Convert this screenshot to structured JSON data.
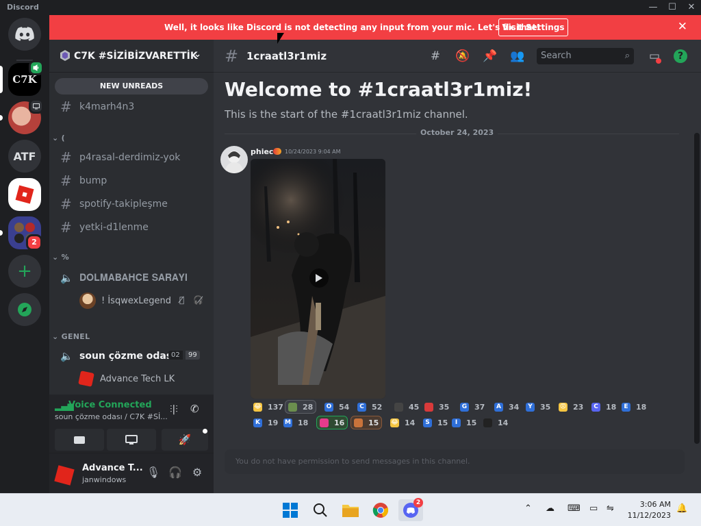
{
  "window": {
    "title": "Discord",
    "min": "—",
    "max": "☐",
    "close": "✕"
  },
  "notice": {
    "text": "Well, it looks like Discord is not detecting any input from your mic. Let's fix that!",
    "button": "Visit Settings",
    "close": "✕"
  },
  "rail": {
    "servers": [
      {
        "name": "Discord home",
        "label": ""
      },
      {
        "name": "C7K",
        "label": "C7K"
      },
      {
        "name": "avatar-server",
        "label": ""
      },
      {
        "name": "ATF",
        "label": "ATF"
      },
      {
        "name": "Roblox",
        "label": ""
      },
      {
        "name": "group-server",
        "label": "",
        "badge": "2"
      },
      {
        "name": "add-server",
        "label": "+"
      },
      {
        "name": "explore",
        "label": ""
      }
    ]
  },
  "server": {
    "name": "C7K #SİZİBİZVARETTİK",
    "new_unreads": "NEW UNREADS"
  },
  "channels": {
    "top": [
      {
        "name": "k4marh4n3"
      }
    ],
    "cat1": {
      "name": "("
    },
    "cat1_items": [
      {
        "name": "p4rasal-derdimiz-yok"
      },
      {
        "name": "bump"
      },
      {
        "name": "spotify-takipleşme"
      },
      {
        "name": "yetki-d1lenme"
      }
    ],
    "cat2": {
      "name": "%"
    },
    "voice1": {
      "name": "𝐃𝐎𝐋𝐌𝐀𝐁𝐀𝐇𝐂𝐄 𝐒𝐀𝐑𝐀𝐘𝐈"
    },
    "voice1_user": {
      "name": "! İsqwexLegend"
    },
    "cat3": {
      "name": "GENEL"
    },
    "voice2": {
      "name": "soun çözme odası",
      "count": "02",
      "limit": "99"
    },
    "voice2_user": {
      "name": "Advance Tech LK"
    }
  },
  "voice": {
    "status": "Voice Connected",
    "location": "soun çözme odası / C7K #Sİ..."
  },
  "user": {
    "name": "Advance T...",
    "tag": "janwindows"
  },
  "channel": {
    "name": "1craatl3r1miz",
    "search_placeholder": "Search",
    "welcome": "Welcome to #1craatl3r1miz!",
    "welcome_sub": "This is the start of the #1craatl3r1miz channel.",
    "date_divider": "October 24, 2023"
  },
  "message": {
    "author": "phiec",
    "timestamp": "10/24/2023 9:04 AM"
  },
  "reactions": [
    {
      "emoji": "😂",
      "count": "137",
      "color": "#f5c542"
    },
    {
      "emoji": "",
      "count": "28",
      "color": "#6b8e4e",
      "me": true
    },
    {
      "emoji": "O",
      "count": "54",
      "color": "#2f6fd8"
    },
    {
      "emoji": "C",
      "count": "52",
      "color": "#2f6fd8"
    },
    {
      "emoji": "",
      "count": "45",
      "color": "#444"
    },
    {
      "emoji": "",
      "count": "35",
      "color": "#d83a3a"
    },
    {
      "emoji": "G",
      "count": "37",
      "color": "#2f6fd8"
    },
    {
      "emoji": "A",
      "count": "34",
      "color": "#2f6fd8"
    },
    {
      "emoji": "Y",
      "count": "35",
      "color": "#2f6fd8"
    },
    {
      "emoji": "😡",
      "count": "23",
      "color": "#f5c542"
    },
    {
      "emoji": "C",
      "count": "18",
      "color": "#5865f2"
    },
    {
      "emoji": "E",
      "count": "18",
      "color": "#2f6fd8"
    },
    {
      "emoji": "K",
      "count": "19",
      "color": "#2f6fd8"
    },
    {
      "emoji": "M",
      "count": "18",
      "color": "#2f6fd8"
    },
    {
      "emoji": "",
      "count": "16",
      "color": "#e63b8c",
      "green": true
    },
    {
      "emoji": "",
      "count": "15",
      "color": "#c9733b",
      "orange": true
    },
    {
      "emoji": "😂",
      "count": "14",
      "color": "#f5c542"
    },
    {
      "emoji": "S",
      "count": "15",
      "color": "#2f6fd8"
    },
    {
      "emoji": "I",
      "count": "15",
      "color": "#2f6fd8"
    },
    {
      "emoji": "",
      "count": "14",
      "color": "#222"
    }
  ],
  "composer": {
    "text": "You do not have permission to send messages in this channel."
  },
  "taskbar": {
    "time": "3:06 AM",
    "date": "11/12/2023",
    "discord_badge": "2"
  }
}
